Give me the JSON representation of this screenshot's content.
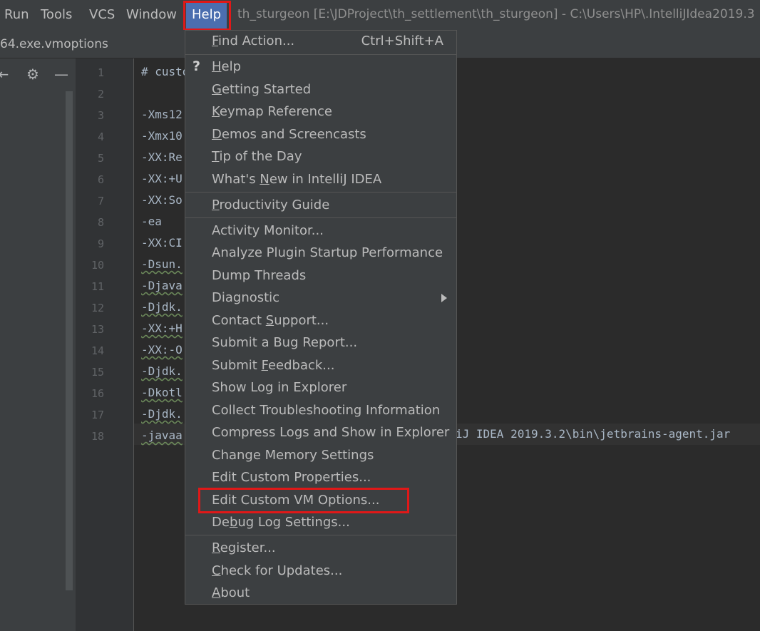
{
  "menubar": {
    "items": [
      "Run",
      "Tools",
      "VCS",
      "Window",
      "Help"
    ],
    "active": "Help"
  },
  "window_title": "th_sturgeon [E:\\JDProject\\th_settlement\\th_sturgeon] - C:\\Users\\HP\\.IntelliJIdea2019.3",
  "tab": {
    "label": "64.exe.vmoptions"
  },
  "editor": {
    "lines": [
      {
        "n": "1",
        "text": "# custo"
      },
      {
        "n": "2",
        "text": ""
      },
      {
        "n": "3",
        "text": "-Xms12"
      },
      {
        "n": "4",
        "text": "-Xmx10"
      },
      {
        "n": "5",
        "text": "-XX:Re"
      },
      {
        "n": "6",
        "text": "-XX:+U"
      },
      {
        "n": "7",
        "text": "-XX:So"
      },
      {
        "n": "8",
        "text": "-ea"
      },
      {
        "n": "9",
        "text": "-XX:CI"
      },
      {
        "n": "10",
        "text": "-Dsun."
      },
      {
        "n": "11",
        "text": "-Djava"
      },
      {
        "n": "12",
        "text": "-Djdk."
      },
      {
        "n": "13",
        "text": "-XX:+H"
      },
      {
        "n": "14",
        "text": "-XX:-O"
      },
      {
        "n": "15",
        "text": "-Djdk."
      },
      {
        "n": "16",
        "text": "-Dkotl"
      },
      {
        "n": "17",
        "text": "-Djdk."
      },
      {
        "n": "18",
        "text": "-javaa"
      }
    ],
    "line18_tail": "iJ IDEA 2019.3.2\\bin\\jetbrains-agent.jar"
  },
  "help_menu": {
    "find_action": {
      "label": "Find Action...",
      "shortcut": "Ctrl+Shift+A"
    },
    "group1": [
      "Help",
      "Getting Started",
      "Keymap Reference",
      "Demos and Screencasts",
      "Tip of the Day",
      "What's New in IntelliJ IDEA"
    ],
    "group2": [
      "Productivity Guide"
    ],
    "group3": [
      "Activity Monitor...",
      "Analyze Plugin Startup Performance",
      "Dump Threads",
      "Diagnostic",
      "Contact Support...",
      "Submit a Bug Report...",
      "Submit Feedback...",
      "Show Log in Explorer",
      "Collect Troubleshooting Information",
      "Compress Logs and Show in Explorer",
      "Change Memory Settings",
      "Edit Custom Properties...",
      "Edit Custom VM Options...",
      "Debug Log Settings..."
    ],
    "group4": [
      "Register...",
      "Check for Updates...",
      "About"
    ]
  },
  "colors": {
    "highlight_box": "#e01818",
    "menu_active": "#4b6eaf"
  }
}
